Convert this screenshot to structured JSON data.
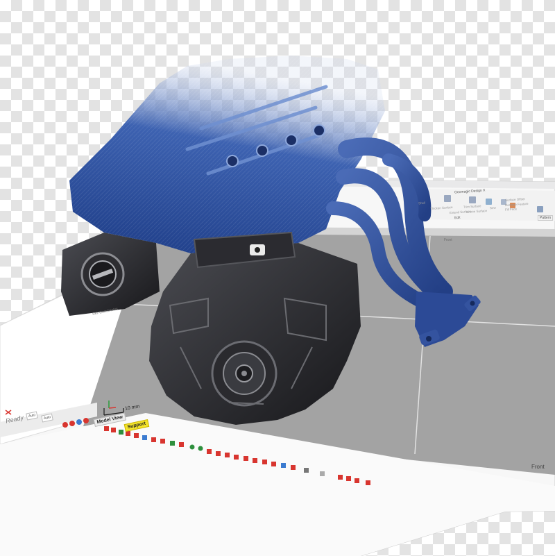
{
  "app": {
    "title": "Geomagic Design X",
    "status": "Ready"
  },
  "ribbon": {
    "buttons": [
      {
        "label": "Shell"
      },
      {
        "label": "Thicken Surface"
      },
      {
        "label": "Extend Surface"
      },
      {
        "label": "Trim Surface"
      },
      {
        "label": "Untrim Surface"
      },
      {
        "label": "Sew"
      },
      {
        "label": "Surface Offset"
      },
      {
        "label": "Remove Feature"
      },
      {
        "label": "Fill Face"
      }
    ],
    "group_edit": "Edit",
    "tab_pattern": "Pattern"
  },
  "viewport": {
    "view_label": "Front",
    "top_label": "Front",
    "scale_label": "10 mm",
    "coord_label": "Rel. Coordinates"
  },
  "bottom_toolbar": {
    "combo_1": "Auto",
    "combo_2": "Auto",
    "tab_model_view": "Model View",
    "tab_support": "Support"
  },
  "colors": {
    "scan_blue": "#2e4f9c",
    "mesh_dark": "#2a2a2e",
    "viewport_gray": "#a3a3a3",
    "support_tab": "#f3e32a",
    "icon_red": "#d8352f"
  }
}
